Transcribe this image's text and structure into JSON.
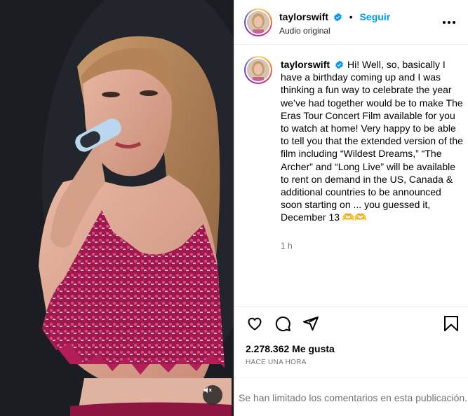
{
  "post": {
    "username": "taylorswift",
    "follow_label": "Seguir",
    "audio_label": "Audio original",
    "caption": "Hi! Well, so, basically I have a birthday coming up and I was thinking a fun way to celebrate the year we’ve had together would be to make The Eras Tour Concert Film available for you to watch at home! Very happy to be able to tell you that the extended version of the film including “Wildest Dreams,” “The Archer” and “Long Live” will be available to rent on demand in the US, Canada & additional countries to be announced soon starting on ... you guessed it, December 13 🫶🫶",
    "time_ago": "1 h",
    "likes": "2.278.362 Me gusta",
    "posted_ago": "HACE UNA HORA",
    "comments_disabled": "Se han limitado los comentarios en esta publicación."
  },
  "icons": {
    "verified": "verified-badge-icon",
    "more": "more-options-icon",
    "like": "heart-icon",
    "comment": "comment-icon",
    "share": "share-icon",
    "save": "bookmark-icon",
    "mute": "muted-speaker-icon"
  },
  "colors": {
    "accent": "#0095f6",
    "secondary_text": "#737373",
    "verified": "#0095f6"
  }
}
